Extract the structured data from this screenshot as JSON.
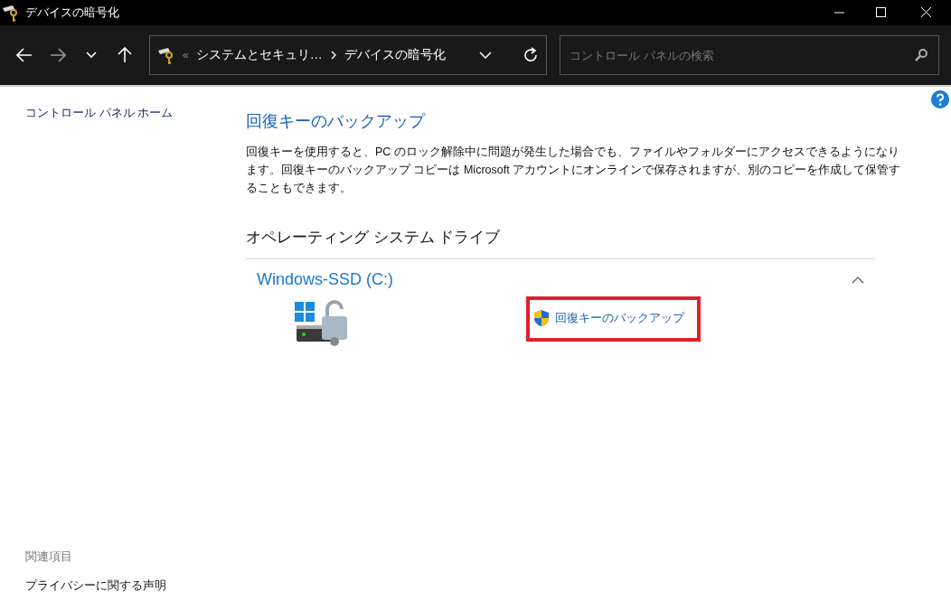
{
  "window": {
    "title": "デバイスの暗号化"
  },
  "address_bar": {
    "overflow": "«",
    "breadcrumbs": [
      "システムとセキュリ…",
      "デバイスの暗号化"
    ]
  },
  "search": {
    "placeholder": "コントロール パネルの検索"
  },
  "sidebar": {
    "home_link": "コントロール パネル ホーム",
    "related_heading": "関連項目",
    "related_links": [
      "プライバシーに関する声明"
    ]
  },
  "main": {
    "heading": "回復キーのバックアップ",
    "description": "回復キーを使用すると、PC のロック解除中に問題が発生した場合でも、ファイルやフォルダーにアクセスできるようになります。回復キーのバックアップ コピーは Microsoft アカウントにオンラインで保存されますが、別のコピーを作成して保管することもできます。",
    "section_heading": "オペレーティング システム ドライブ",
    "drives": [
      {
        "name": "Windows-SSD (C:)",
        "expanded": true,
        "action": "回復キーのバックアップ",
        "highlighted": true
      }
    ]
  }
}
